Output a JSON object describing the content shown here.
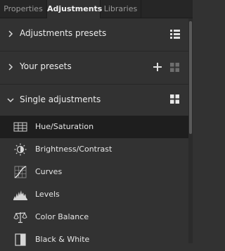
{
  "tabs": [
    {
      "label": "Properties",
      "active": false
    },
    {
      "label": "Adjustments",
      "active": true
    },
    {
      "label": "Libraries",
      "active": false
    }
  ],
  "sections": {
    "presets": {
      "label": "Adjustments presets",
      "expanded": false,
      "action_icon": "list-view-icon"
    },
    "your_presets": {
      "label": "Your presets",
      "expanded": false,
      "action_icons": [
        "plus-icon",
        "grid-view-icon"
      ]
    },
    "single": {
      "label": "Single adjustments",
      "expanded": true,
      "action_icon": "grid-view-icon"
    }
  },
  "adjustments": [
    {
      "label": "Hue/Saturation",
      "icon": "hue-saturation-icon",
      "selected": true
    },
    {
      "label": "Brightness/Contrast",
      "icon": "brightness-contrast-icon",
      "selected": false
    },
    {
      "label": "Curves",
      "icon": "curves-icon",
      "selected": false
    },
    {
      "label": "Levels",
      "icon": "levels-icon",
      "selected": false
    },
    {
      "label": "Color Balance",
      "icon": "color-balance-icon",
      "selected": false
    },
    {
      "label": "Black & White",
      "icon": "black-white-icon",
      "selected": false
    }
  ],
  "colors": {
    "panel_bg": "#323232",
    "tabbar_bg": "#262626",
    "selected_row": "#1e1e1e",
    "text": "#e6e6e6"
  }
}
